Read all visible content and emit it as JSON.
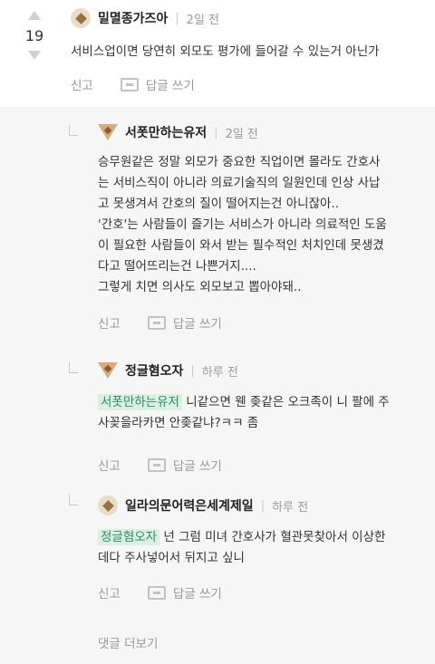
{
  "top_comment": {
    "vote_count": "19",
    "author": "밀멸종가즈아",
    "time": "2일 전",
    "text": "서비스업이면 당연히 외모도 평가에 들어갈 수 있는거 아닌가",
    "report_label": "신고",
    "reply_label": "답글 쓰기"
  },
  "replies": [
    {
      "author": "서폿만하는유저",
      "time": "2일 전",
      "lines": [
        "승무원같은 정말 외모가 중요한 직업이면 몰라도 간호사",
        "는 서비스직이 아니라 의료기술직의 일원인데 인상 사납",
        "고 못생겨서 간호의 질이 떨어지는건 아니잖아..",
        "'간호'는 사람들이 즐기는 서비스가 아니라 의료적인 도움",
        "이 필요한 사람들이 와서 받는 필수적인 처치인데 못생겼",
        "다고 떨어뜨리는건 나쁜거지....",
        "그렇게 치면 의사도 외모보고 뽑아야돼.."
      ],
      "report_label": "신고",
      "reply_label": "답글 쓰기"
    },
    {
      "author": "정글혐오자",
      "time": "하루 전",
      "mention": "서폿만하는유저",
      "line1_rest": " 니같으면 웬 좆같은 오크족이 니 팔에 주",
      "line2": "사꽂을라카면 안좆같냐?ㅋㅋ 좀",
      "report_label": "신고",
      "reply_label": "답글 쓰기"
    },
    {
      "author": "일라의문어력은세계제일",
      "time": "하루 전",
      "mention": "정글혐오자",
      "line1_rest": " 넌 그럼 미녀 간호사가 혈관못찾아서 이상한",
      "line2": "데다 주사넣어서 뒤지고 싶니",
      "report_label": "신고",
      "reply_label": "답글 쓰기"
    }
  ],
  "more_replies_label": "댓글 더보기"
}
